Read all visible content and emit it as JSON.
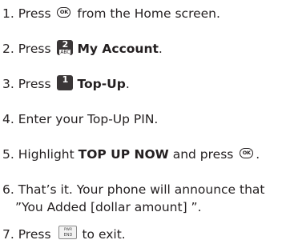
{
  "steps": [
    {
      "number": "1.",
      "before": "Press",
      "after": "from the Home screen.",
      "key": {
        "icon": "ok-key-icon",
        "label": "OK"
      }
    },
    {
      "number": "2.",
      "before": "Press",
      "bold": "My Account",
      "after": ".",
      "key": {
        "icon": "key-2-icon",
        "digit": "2",
        "letters": "ABC"
      }
    },
    {
      "number": "3.",
      "before": "Press",
      "bold": "Top-Up",
      "after": ".",
      "key": {
        "icon": "key-1-icon",
        "digit": "1",
        "letters": ""
      }
    },
    {
      "number": "4.",
      "text": "Enter your Top-Up PIN."
    },
    {
      "number": "5.",
      "before": "Highlight",
      "bold": "TOP UP NOW",
      "middle": "and press",
      "after": ".",
      "key": {
        "icon": "ok-key-icon",
        "label": "OK"
      }
    },
    {
      "number": "6.",
      "line1": "That’s it. Your phone will announce that",
      "line2": "”You Added [dollar amount] ”."
    },
    {
      "number": "7.",
      "before": "Press",
      "after": "to exit.",
      "key": {
        "icon": "end-key-icon",
        "top": "PWR",
        "bottom": "END"
      }
    }
  ]
}
